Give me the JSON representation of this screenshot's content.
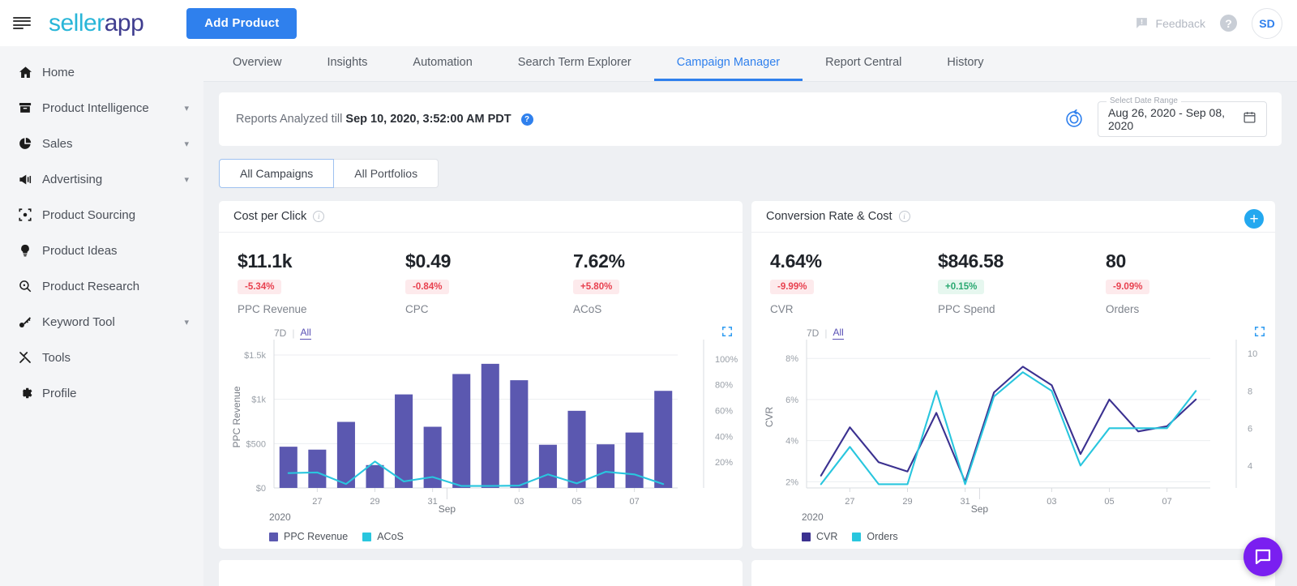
{
  "app": {
    "logo_part1": "seller",
    "logo_part2": "app",
    "add_product_label": "Add Product",
    "feedback_label": "Feedback",
    "help_glyph": "?",
    "avatar_initials": "SD"
  },
  "sidebar": {
    "items": [
      {
        "label": "Home",
        "icon": "home-icon",
        "expandable": false
      },
      {
        "label": "Product Intelligence",
        "icon": "box-icon",
        "expandable": true
      },
      {
        "label": "Sales",
        "icon": "pie-chart-icon",
        "expandable": true
      },
      {
        "label": "Advertising",
        "icon": "megaphone-icon",
        "expandable": true
      },
      {
        "label": "Product Sourcing",
        "icon": "target-icon",
        "expandable": false
      },
      {
        "label": "Product Ideas",
        "icon": "lightbulb-icon",
        "expandable": false
      },
      {
        "label": "Product Research",
        "icon": "search-icon",
        "expandable": false
      },
      {
        "label": "Keyword Tool",
        "icon": "key-icon",
        "expandable": true
      },
      {
        "label": "Tools",
        "icon": "tools-icon",
        "expandable": false
      },
      {
        "label": "Profile",
        "icon": "gear-icon",
        "expandable": false
      }
    ]
  },
  "tabs": [
    {
      "label": "Overview",
      "active": false
    },
    {
      "label": "Insights",
      "active": false
    },
    {
      "label": "Automation",
      "active": false
    },
    {
      "label": "Search Term Explorer",
      "active": false
    },
    {
      "label": "Campaign Manager",
      "active": true
    },
    {
      "label": "Report Central",
      "active": false
    },
    {
      "label": "History",
      "active": false
    }
  ],
  "reports": {
    "prefix": "Reports Analyzed till",
    "timestamp": "Sep 10, 2020, 3:52:00 AM PDT",
    "info_glyph": "?"
  },
  "daterange": {
    "legend": "Select Date Range",
    "value": "Aug 26, 2020 - Sep 08, 2020"
  },
  "scope_toggle": {
    "options": [
      "All Campaigns",
      "All Portfolios"
    ],
    "selected": "All Campaigns"
  },
  "card1": {
    "title": "Cost per Click",
    "kpis": [
      {
        "value": "$11.1k",
        "delta": "-5.34%",
        "direction": "neg",
        "label": "PPC Revenue"
      },
      {
        "value": "$0.49",
        "delta": "-0.84%",
        "direction": "neg",
        "label": "CPC"
      },
      {
        "value": "7.62%",
        "delta": "+5.80%",
        "direction": "neg",
        "label": "ACoS"
      }
    ],
    "range_options": [
      "7D",
      "All"
    ],
    "range_selected": "All",
    "year_label": "2020"
  },
  "card2": {
    "title": "Conversion Rate & Cost",
    "kpis": [
      {
        "value": "4.64%",
        "delta": "-9.99%",
        "direction": "neg",
        "label": "CVR"
      },
      {
        "value": "$846.58",
        "delta": "+0.15%",
        "direction": "pos",
        "label": "PPC Spend"
      },
      {
        "value": "80",
        "delta": "-9.09%",
        "direction": "neg",
        "label": "Orders"
      }
    ],
    "range_options": [
      "7D",
      "All"
    ],
    "range_selected": "All",
    "year_label": "2020"
  },
  "colors": {
    "accent_blue": "#2f80ed",
    "bar_purple": "#5b58b0",
    "line_cyan": "#29c6de",
    "line_indigo": "#3b3190",
    "positive": "#2aa971",
    "negative": "#e8414f",
    "chat_purple": "#7a1ff0"
  },
  "chart_data": [
    {
      "type": "bar",
      "title": "Cost per Click",
      "xlabel": "Sep",
      "ylabel": "PPC Revenue",
      "y2label": "ACoS",
      "ylim": [
        0,
        1600
      ],
      "y2lim": [
        0,
        110
      ],
      "yticks": [
        "$0",
        "$500",
        "$1k",
        "$1.5k"
      ],
      "y2ticks": [
        "20%",
        "40%",
        "60%",
        "80%",
        "100%"
      ],
      "grid": true,
      "legend": [
        "PPC Revenue",
        "ACoS"
      ],
      "legend_position": "bottom-left",
      "x": [
        "26",
        "27",
        "28",
        "29",
        "30",
        "31",
        "01",
        "02",
        "03",
        "04",
        "05",
        "06",
        "07",
        "08"
      ],
      "xtick_labels": [
        "",
        "27",
        "",
        "29",
        "",
        "31",
        "",
        "",
        "03",
        "",
        "05",
        "",
        "07",
        ""
      ],
      "series": [
        {
          "name": "PPC Revenue",
          "type": "bar",
          "values": [
            465,
            432,
            745,
            258,
            1055,
            690,
            1285,
            1400,
            1215,
            487,
            870,
            492,
            625,
            1095
          ]
        },
        {
          "name": "ACoS",
          "type": "line",
          "values": [
            11.5,
            12.0,
            3.0,
            20.5,
            5.0,
            8.5,
            1.5,
            1.5,
            1.8,
            10.5,
            3.5,
            12.5,
            10.5,
            3.0
          ]
        }
      ]
    },
    {
      "type": "line",
      "title": "Conversion Rate & Cost",
      "xlabel": "Sep",
      "ylabel": "CVR",
      "y2label": "Orders",
      "ylim": [
        1.7,
        8.6
      ],
      "y2lim": [
        2.8,
        10.4
      ],
      "yticks": [
        "2%",
        "4%",
        "6%",
        "8%"
      ],
      "y2ticks": [
        "4",
        "6",
        "8",
        "10"
      ],
      "grid": true,
      "legend": [
        "CVR",
        "Orders"
      ],
      "legend_position": "bottom-left",
      "x": [
        "26",
        "27",
        "28",
        "29",
        "30",
        "31",
        "01",
        "02",
        "03",
        "04",
        "05",
        "06",
        "07",
        "08"
      ],
      "xtick_labels": [
        "",
        "27",
        "",
        "29",
        "",
        "31",
        "",
        "",
        "03",
        "",
        "05",
        "",
        "07",
        ""
      ],
      "series": [
        {
          "name": "CVR",
          "values": [
            2.3,
            4.65,
            2.95,
            2.5,
            5.35,
            2.0,
            6.35,
            7.6,
            6.7,
            3.35,
            6.0,
            4.45,
            4.7,
            6.0
          ]
        },
        {
          "name": "Orders",
          "values": [
            3.0,
            5.0,
            3.0,
            3.0,
            8.0,
            3.0,
            7.7,
            9.0,
            8.0,
            4.0,
            6.0,
            6.0,
            6.0,
            8.0
          ]
        }
      ]
    }
  ]
}
